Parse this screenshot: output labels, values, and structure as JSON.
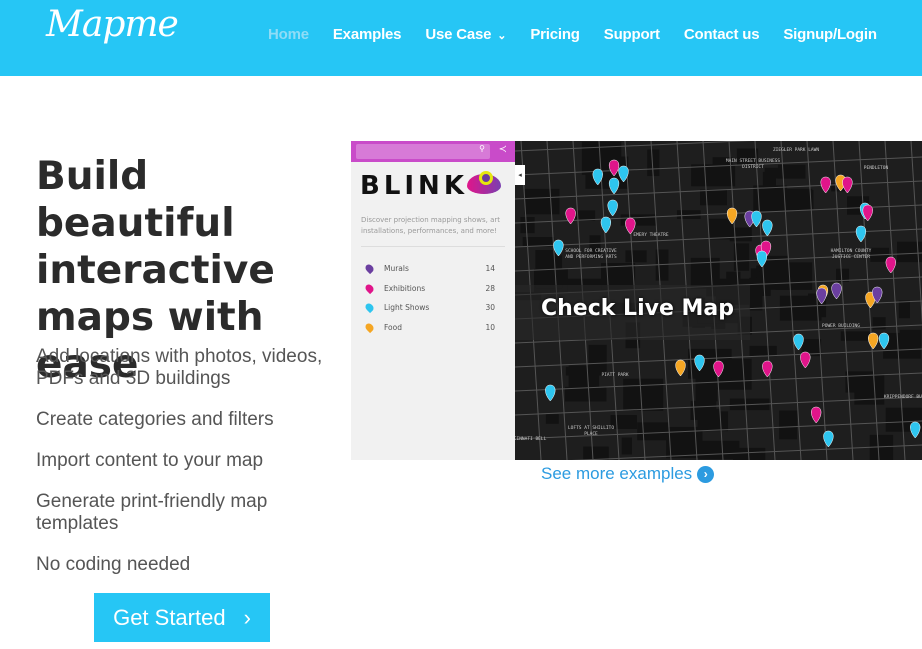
{
  "header": {
    "logo": "Mapme",
    "nav": [
      {
        "label": "Home",
        "active": true
      },
      {
        "label": "Examples"
      },
      {
        "label": "Use Case",
        "dropdown": true
      },
      {
        "label": "Pricing"
      },
      {
        "label": "Support"
      },
      {
        "label": "Contact us"
      },
      {
        "label": "Signup/Login"
      }
    ],
    "background": "#26c6f5"
  },
  "hero": {
    "title": "Build beautiful interactive maps with ease",
    "features": [
      "Add locations with photos, videos, PDFs and 3D buildings",
      "Create categories and filters",
      "Import content to your map",
      "Generate print-friendly map templates",
      "No coding needed"
    ],
    "cta_label": "Get Started",
    "cta_icon": "chevron-right-icon"
  },
  "preview": {
    "brand": "BLINK",
    "description": "Discover projection mapping shows, art installations, performances, and more!",
    "categories": [
      {
        "label": "Murals",
        "count": "14",
        "color": "#6b3fa0"
      },
      {
        "label": "Exhibitions",
        "count": "28",
        "color": "#e0158a"
      },
      {
        "label": "Light Shows",
        "count": "30",
        "color": "#2ec5ef"
      },
      {
        "label": "Food",
        "count": "10",
        "color": "#f5a623"
      }
    ],
    "overlay_label": "Check Live Map",
    "map_labels": [
      "ZIEGLER PARK LAWN",
      "MAIN STREET BUSINESS DISTRICT",
      "PENDLETON",
      "SCHOOL FOR CREATIVE AND PERFORMING ARTS",
      "EMERY THEATRE",
      "HAMILTON COUNTY JUSTICE CENTER",
      "POWER BUILDING",
      "PIATT PARK",
      "LOFTS AT SHILLITO PLACE",
      "KRIPPENDORF BUILDING",
      "CINCINNATI BELL"
    ]
  },
  "more_examples": "See more examples"
}
